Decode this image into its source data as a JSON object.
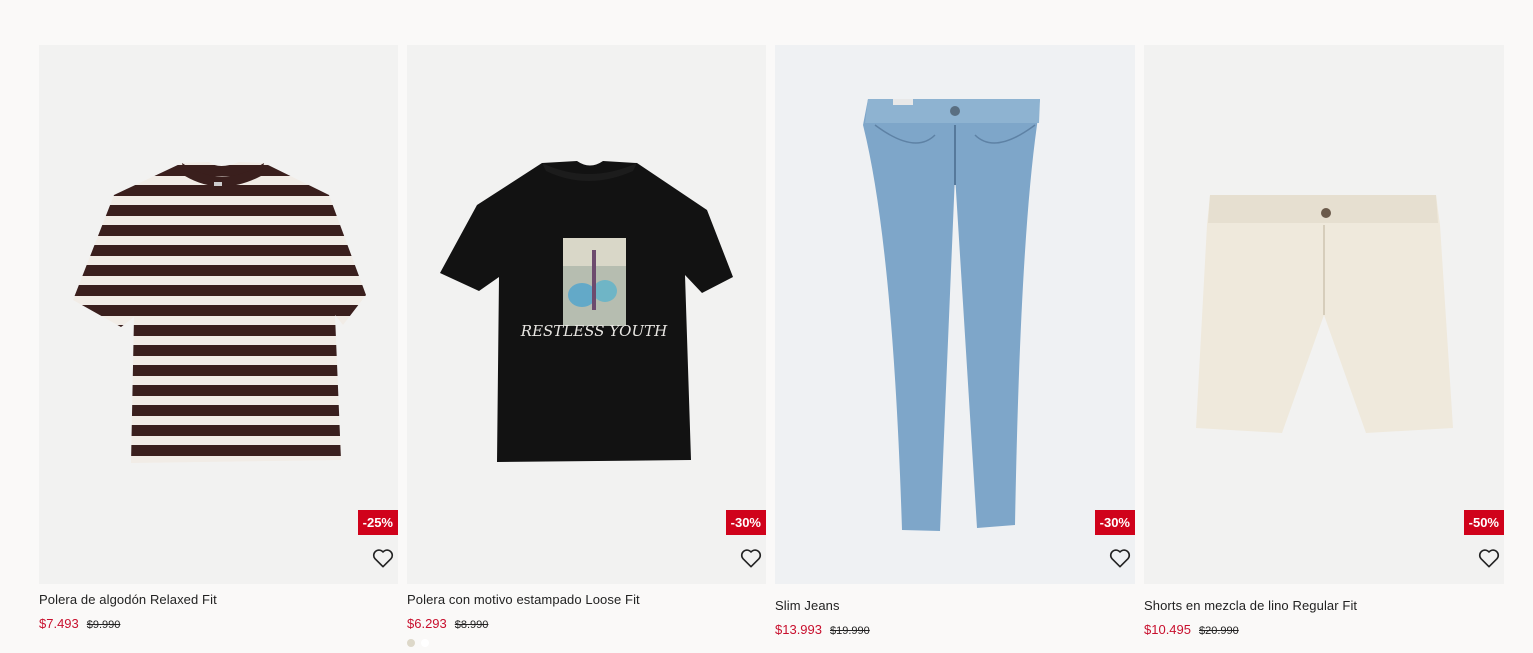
{
  "colors": {
    "sale": "#c8102e",
    "badge": "#d0021b",
    "background": "#faf9f8"
  },
  "products": [
    {
      "name": "Polera de algodón Relaxed Fit",
      "price": "$7.493",
      "original_price": "$9.990",
      "discount": "-25%",
      "favorite_icon": "heart-outline-icon",
      "swatches": []
    },
    {
      "name": "Polera con motivo estampado Loose Fit",
      "price": "$6.293",
      "original_price": "$8.990",
      "discount": "-30%",
      "favorite_icon": "heart-outline-icon",
      "graphic_text": "RESTLESS YOUTH",
      "swatches": [
        "#ddd8c9",
        "#ffffff"
      ]
    },
    {
      "name": "Slim Jeans",
      "price": "$13.993",
      "original_price": "$19.990",
      "discount": "-30%",
      "favorite_icon": "heart-outline-icon",
      "swatches": []
    },
    {
      "name": "Shorts en mezcla de lino Regular Fit",
      "price": "$10.495",
      "original_price": "$20.990",
      "discount": "-50%",
      "favorite_icon": "heart-outline-icon",
      "swatches": []
    }
  ]
}
